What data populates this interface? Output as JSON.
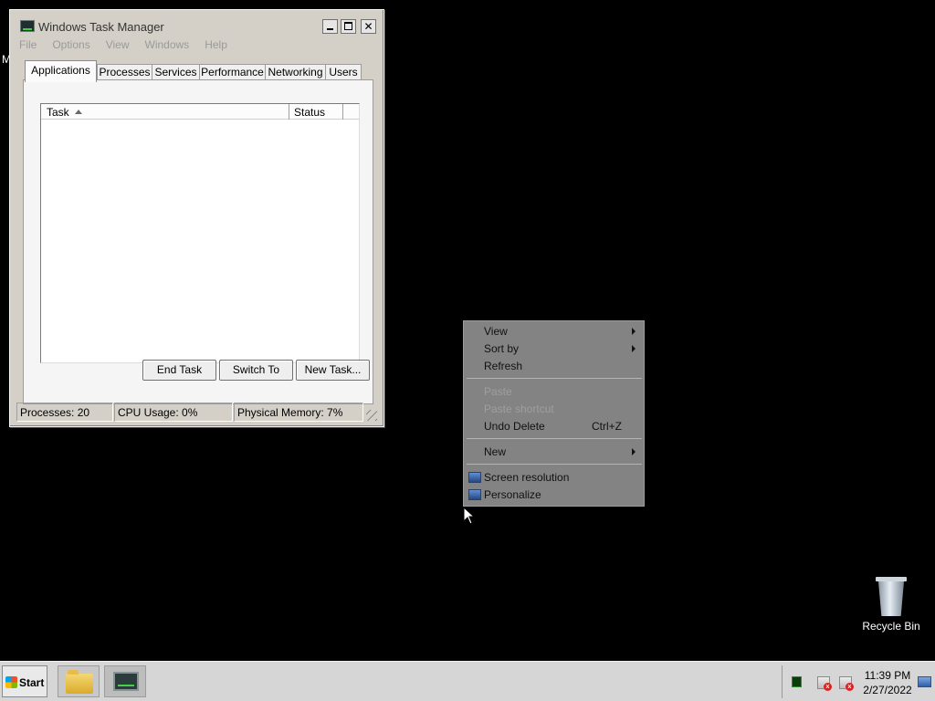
{
  "desktop": {
    "stray_char": "M",
    "recycle_bin_label": "Recycle Bin"
  },
  "task_manager": {
    "title": "Windows Task Manager",
    "menus": [
      "File",
      "Options",
      "View",
      "Windows",
      "Help"
    ],
    "tabs": [
      "Applications",
      "Processes",
      "Services",
      "Performance",
      "Networking",
      "Users"
    ],
    "active_tab": "Applications",
    "columns": [
      "Task",
      "Status"
    ],
    "rows": [],
    "buttons": {
      "end_task": "End Task",
      "switch_to": "Switch To",
      "new_task": "New Task..."
    },
    "status": {
      "processes": "Processes: 20",
      "cpu": "CPU Usage: 0%",
      "memory": "Physical Memory: 7%"
    },
    "window_buttons": {
      "close": "✕"
    }
  },
  "context_menu": {
    "items": [
      {
        "label": "View",
        "submenu": true,
        "enabled": true
      },
      {
        "label": "Sort by",
        "submenu": true,
        "enabled": true
      },
      {
        "label": "Refresh",
        "enabled": true
      },
      {
        "label": "Paste",
        "enabled": false
      },
      {
        "label": "Paste shortcut",
        "enabled": false
      },
      {
        "label": "Undo Delete",
        "shortcut": "Ctrl+Z",
        "enabled": true
      },
      {
        "label": "New",
        "submenu": true,
        "enabled": true
      },
      {
        "label": "Screen resolution",
        "icon": "display-icon",
        "enabled": true
      },
      {
        "label": "Personalize",
        "icon": "personalize-icon",
        "enabled": true
      }
    ]
  },
  "taskbar": {
    "start_label": "Start",
    "pinned": [
      "windows-explorer-icon",
      "task-manager-icon"
    ],
    "tray_icons": [
      "task-manager-mini-icon",
      "action-center-flag-icon",
      "speaker-icon",
      "show-desktop-icon"
    ],
    "clock_time": "11:39 PM",
    "clock_date": "2/27/2022"
  },
  "colors": {
    "desktop_bg": "#000000",
    "menu_bg": "#838383",
    "window_bg": "#d4d0c8",
    "taskbar_bg": "#d6d6d6"
  }
}
